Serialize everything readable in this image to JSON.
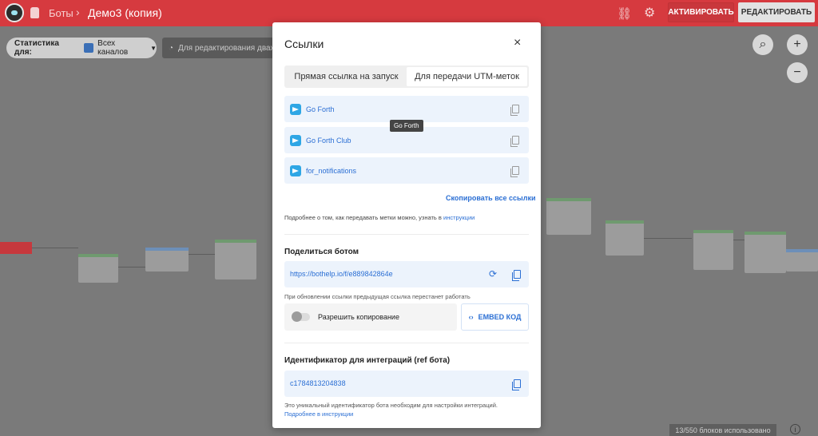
{
  "topbar": {
    "bots": "Боты",
    "separator": "›",
    "title": "Демо3 (копия)",
    "activate_label": "АКТИВИРОВАТЬ",
    "edit_label": "РЕДАКТИРОВАТЬ"
  },
  "toolbar": {
    "stats_label": "Статистика для:",
    "channel_value": "Всех каналов",
    "hint": "Для редактирования дважды"
  },
  "zoom": {
    "search": "⌕",
    "in": "+",
    "out": "−"
  },
  "footer": {
    "counter": "13/550 блоков использовано",
    "info": "i"
  },
  "modal": {
    "title": "Ссылки",
    "close": "×",
    "tabs": [
      "Прямая ссылка на запуск",
      "Для передачи UTM-меток"
    ],
    "links": [
      "Go Forth",
      "Go Forth Club",
      "for_notifications"
    ],
    "tooltip": "Go Forth",
    "copy_all": "Скопировать все ссылки",
    "help_text": "Подробнее о том, как передавать метки можно, узнать в",
    "help_link": "инструкции",
    "share": {
      "title": "Поделиться ботом",
      "url": "https://bothelp.io/f/e889842864e",
      "note": "При обновлении ссылки предыдущая ссылка перестанет работать",
      "allow_copy": "Разрешить копирование",
      "embed": "EMBED КОД"
    },
    "ref": {
      "title": "Идентификатор для интеграций (ref бота)",
      "value": "c1784813204838",
      "note": "Это уникальный идентификатор бота необходим для настройки интеграций.",
      "link": "Подробнее в инструкции"
    }
  }
}
